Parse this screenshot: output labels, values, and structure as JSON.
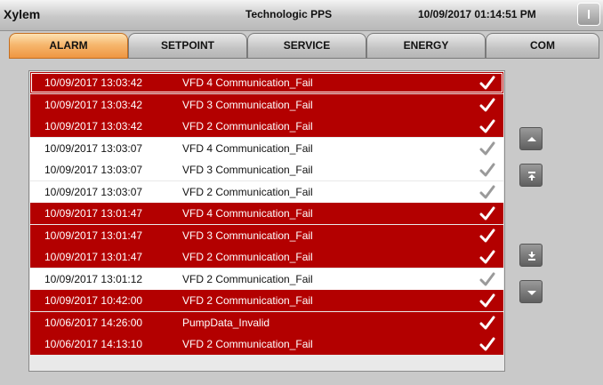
{
  "header": {
    "brand": "Xylem",
    "product": "Technologic PPS",
    "datetime": "10/09/2017 01:14:51 PM",
    "info_icon": "info-icon"
  },
  "tabs": [
    {
      "label": "ALARM",
      "active": true
    },
    {
      "label": "SETPOINT",
      "active": false
    },
    {
      "label": "SERVICE",
      "active": false
    },
    {
      "label": "ENERGY",
      "active": false
    },
    {
      "label": "COM",
      "active": false
    }
  ],
  "alarms": [
    {
      "time": "10/09/2017 13:03:42",
      "message": "VFD 4 Communication_Fail",
      "status": "active"
    },
    {
      "time": "10/09/2017 13:03:42",
      "message": "VFD 3 Communication_Fail",
      "status": "active"
    },
    {
      "time": "10/09/2017 13:03:42",
      "message": "VFD 2 Communication_Fail",
      "status": "active"
    },
    {
      "time": "10/09/2017 13:03:07",
      "message": "VFD 4 Communication_Fail",
      "status": "cleared"
    },
    {
      "time": "10/09/2017 13:03:07",
      "message": "VFD 3 Communication_Fail",
      "status": "cleared"
    },
    {
      "time": "10/09/2017 13:03:07",
      "message": "VFD 2 Communication_Fail",
      "status": "cleared"
    },
    {
      "time": "10/09/2017 13:01:47",
      "message": "VFD 4 Communication_Fail",
      "status": "active"
    },
    {
      "time": "10/09/2017 13:01:47",
      "message": "VFD 3 Communication_Fail",
      "status": "active"
    },
    {
      "time": "10/09/2017 13:01:47",
      "message": "VFD 2 Communication_Fail",
      "status": "active"
    },
    {
      "time": "10/09/2017 13:01:12",
      "message": "VFD 2 Communication_Fail",
      "status": "cleared"
    },
    {
      "time": "10/09/2017 10:42:00",
      "message": "VFD 2 Communication_Fail",
      "status": "active"
    },
    {
      "time": "10/06/2017 14:26:00",
      "message": "PumpData_Invalid",
      "status": "active"
    },
    {
      "time": "10/06/2017 14:13:10",
      "message": "VFD 2 Communication_Fail",
      "status": "active"
    }
  ],
  "scroll_buttons": [
    {
      "name": "scroll-up-button",
      "icon": "arrow-up-icon"
    },
    {
      "name": "scroll-top-button",
      "icon": "arrow-to-top-icon"
    },
    {
      "name": "scroll-bottom-button",
      "icon": "arrow-to-bottom-icon"
    },
    {
      "name": "scroll-down-button",
      "icon": "arrow-down-icon"
    }
  ],
  "colors": {
    "active_row": "#b30000",
    "cleared_row": "#ffffff",
    "tab_active": "#ef9641"
  }
}
